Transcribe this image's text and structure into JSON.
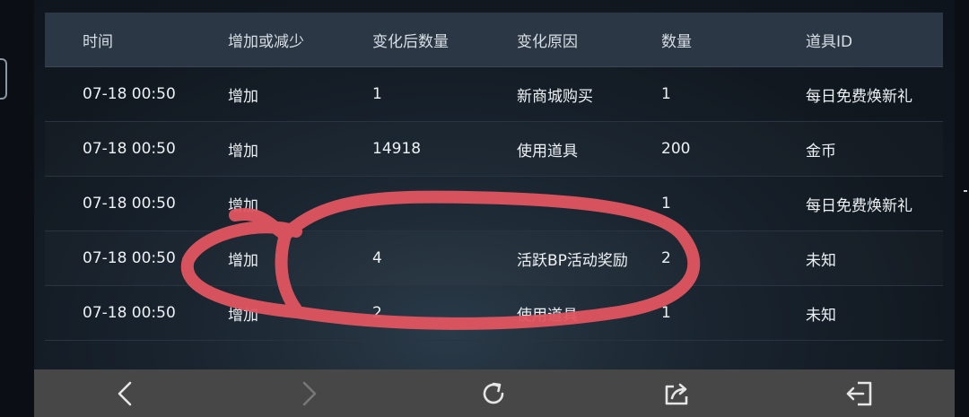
{
  "table": {
    "headers": [
      "时间",
      "增加或减少",
      "变化后数量",
      "变化原因",
      "数量",
      "道具ID"
    ],
    "rows": [
      [
        "07-18 00:50",
        "增加",
        "1",
        "新商城购买",
        "1",
        "每日免费焕新礼"
      ],
      [
        "07-18 00:50",
        "增加",
        "14918",
        "使用道具",
        "200",
        "金币"
      ],
      [
        "07-18 00:50",
        "增加",
        "",
        "",
        "1",
        "每日免费焕新礼"
      ],
      [
        "07-18 00:50",
        "增加",
        "4",
        "活跃BP活动奖励",
        "2",
        "未知"
      ],
      [
        "07-18 00:50",
        "增加",
        "2",
        "使用道具",
        "1",
        "未知"
      ]
    ]
  },
  "navbar": {
    "items": [
      "back-icon",
      "forward-icon",
      "refresh-icon",
      "share-icon",
      "exit-icon"
    ]
  },
  "colors": {
    "header_bg": "#2b3744",
    "navbar_bg": "#474747",
    "scribble": "#e05560"
  }
}
